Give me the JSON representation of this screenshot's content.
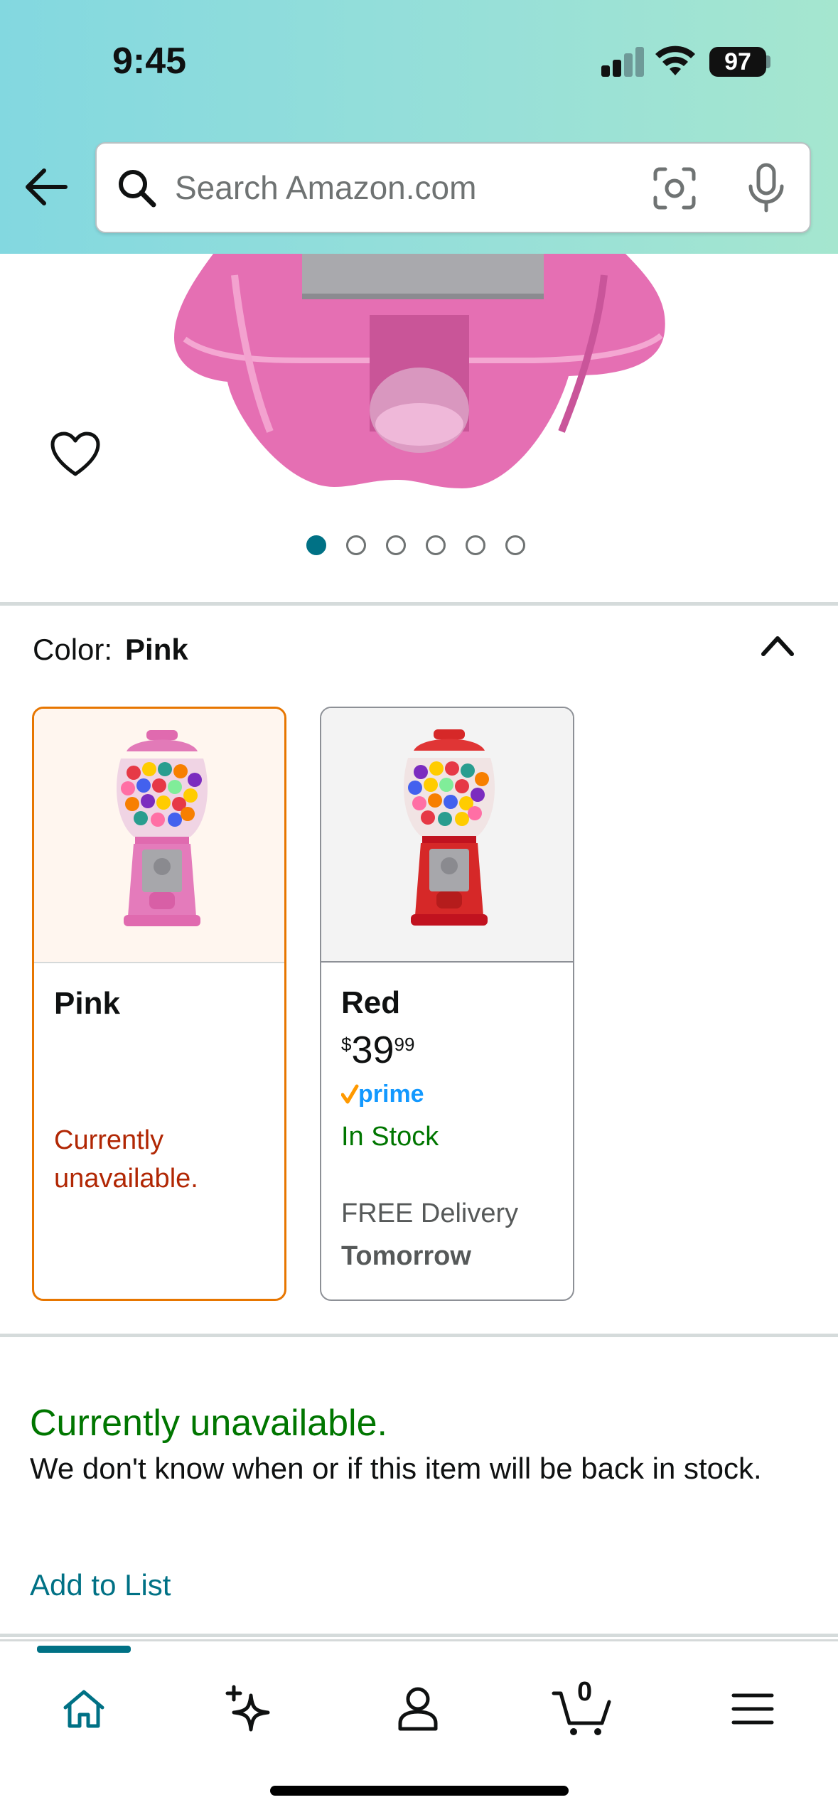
{
  "status_bar": {
    "time": "9:45",
    "battery": "97"
  },
  "search": {
    "placeholder": "Search Amazon.com"
  },
  "gallery": {
    "image_count": 6,
    "active_index": 0
  },
  "colors": {
    "brand_teal": "#007185",
    "selected_border": "#e77600",
    "unavailable_red": "#b12704",
    "in_stock_green": "#007600"
  },
  "color_selector": {
    "label": "Color:",
    "selected": "Pink",
    "options": [
      {
        "name": "Pink",
        "availability": "Currently unavailable."
      },
      {
        "name": "Red",
        "price_symbol": "$",
        "price_whole": "39",
        "price_fraction": "99",
        "badge": "prime",
        "stock": "In Stock",
        "delivery_label": "FREE Delivery",
        "delivery_date": "Tomorrow"
      }
    ]
  },
  "availability": {
    "title": "Currently unavailable.",
    "description": "We don't know when or if this item will be back in stock.",
    "add_to_list": "Add to List"
  },
  "bottom_nav": {
    "items": [
      "home-icon",
      "ai-sparkle-icon",
      "account-icon",
      "cart-icon",
      "menu-icon"
    ],
    "cart_count": "0"
  }
}
